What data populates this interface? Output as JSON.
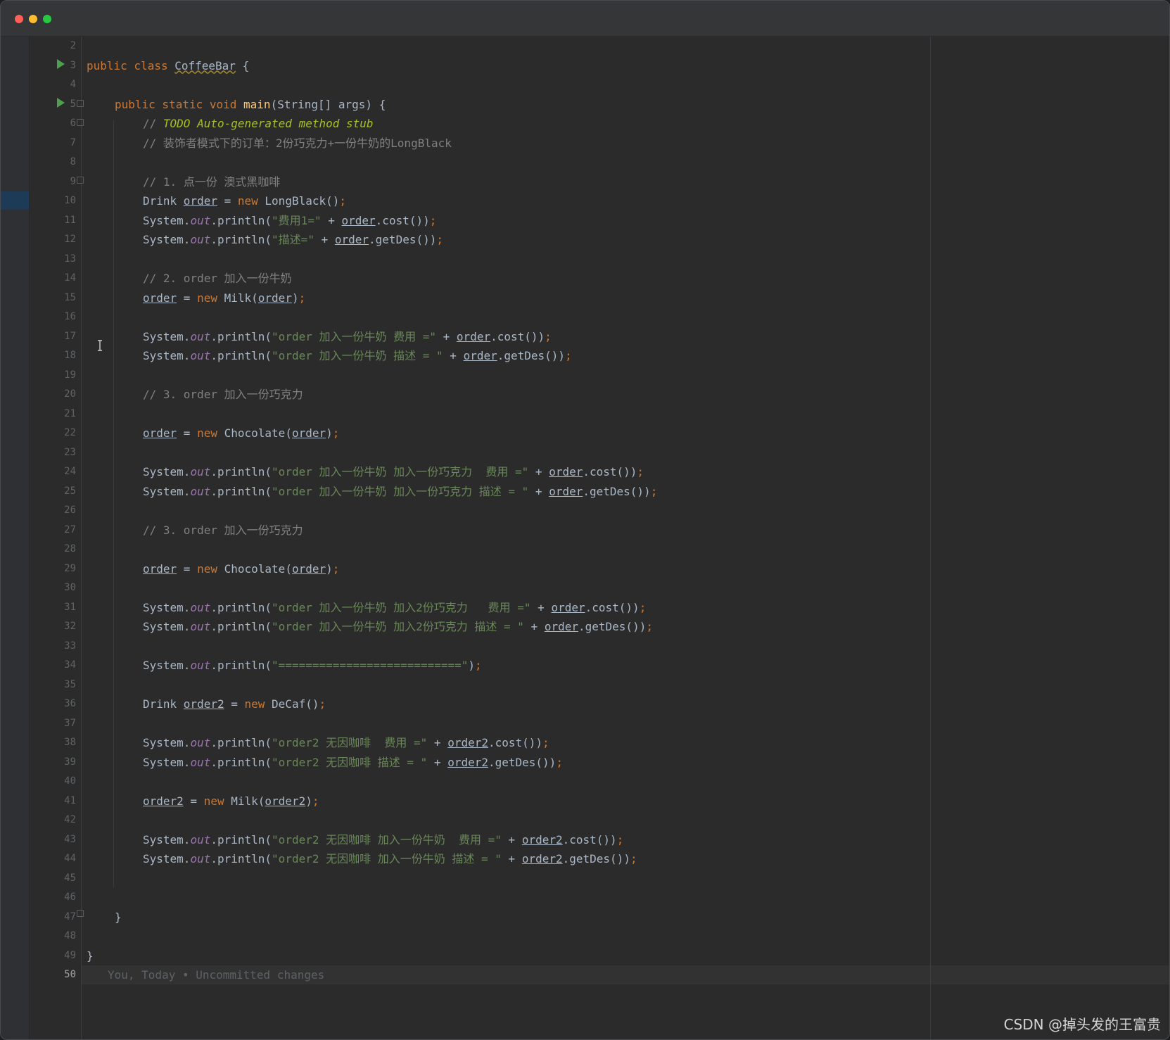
{
  "editor": {
    "current_line": "50",
    "blame_text": "You, Today • Uncommitted changes",
    "line_numbers": [
      "2",
      "3",
      "4",
      "5",
      "6",
      "7",
      "8",
      "9",
      "10",
      "11",
      "12",
      "13",
      "14",
      "15",
      "16",
      "17",
      "18",
      "19",
      "20",
      "21",
      "22",
      "23",
      "24",
      "25",
      "26",
      "27",
      "28",
      "29",
      "30",
      "31",
      "32",
      "33",
      "34",
      "35",
      "36",
      "37",
      "38",
      "39",
      "40",
      "41",
      "42",
      "43",
      "44",
      "45",
      "46",
      "47",
      "48",
      "49",
      "50"
    ]
  },
  "code": {
    "l3": {
      "kw": "public class ",
      "cls": "CoffeeBar",
      "rest": " {"
    },
    "l5": {
      "kw": "public static void ",
      "fn": "main",
      "rest": "(String[] args) {"
    },
    "l6": {
      "prefix": "// ",
      "todo": "TODO Auto-generated method stub"
    },
    "l7": {
      "text": "// 装饰者模式下的订单：2份巧克力+一份牛奶的LongBlack"
    },
    "l9": {
      "text": "// 1. 点一份 澳式黑咖啡"
    },
    "l10": {
      "t1": "Drink ",
      "v": "order",
      "t2": " = ",
      "kw": "new",
      "t3": " LongBlack()",
      "semi": ";"
    },
    "l11": {
      "sys": "System.",
      "out": "out",
      "pr": ".println(",
      "str": "\"费用1=\"",
      "plus": " + ",
      "v": "order",
      "end": ".cost())",
      "semi": ";"
    },
    "l12": {
      "sys": "System.",
      "out": "out",
      "pr": ".println(",
      "str": "\"描述=\"",
      "plus": " + ",
      "v": "order",
      "end": ".getDes())",
      "semi": ";"
    },
    "l14": {
      "text": "// 2. order 加入一份牛奶"
    },
    "l15": {
      "v": "order",
      "t2": " = ",
      "kw": "new",
      "t3": " Milk(",
      "v2": "order",
      "t4": ")",
      "semi": ";"
    },
    "l17": {
      "sys": "System.",
      "out": "out",
      "pr": ".println(",
      "str": "\"order 加入一份牛奶 费用 =\"",
      "plus": " + ",
      "v": "order",
      "end": ".cost())",
      "semi": ";"
    },
    "l18": {
      "sys": "System.",
      "out": "out",
      "pr": ".println(",
      "str": "\"order 加入一份牛奶 描述 = \"",
      "plus": " + ",
      "v": "order",
      "end": ".getDes())",
      "semi": ";"
    },
    "l20": {
      "text": "// 3. order 加入一份巧克力"
    },
    "l22": {
      "v": "order",
      "t2": " = ",
      "kw": "new",
      "t3": " Chocolate(",
      "v2": "order",
      "t4": ")",
      "semi": ";"
    },
    "l24": {
      "sys": "System.",
      "out": "out",
      "pr": ".println(",
      "str": "\"order 加入一份牛奶 加入一份巧克力  费用 =\"",
      "plus": " + ",
      "v": "order",
      "end": ".cost())",
      "semi": ";"
    },
    "l25": {
      "sys": "System.",
      "out": "out",
      "pr": ".println(",
      "str": "\"order 加入一份牛奶 加入一份巧克力 描述 = \"",
      "plus": " + ",
      "v": "order",
      "end": ".getDes())",
      "semi": ";"
    },
    "l27": {
      "text": "// 3. order 加入一份巧克力"
    },
    "l29": {
      "v": "order",
      "t2": " = ",
      "kw": "new",
      "t3": " Chocolate(",
      "v2": "order",
      "t4": ")",
      "semi": ";"
    },
    "l31": {
      "sys": "System.",
      "out": "out",
      "pr": ".println(",
      "str": "\"order 加入一份牛奶 加入2份巧克力   费用 =\"",
      "plus": " + ",
      "v": "order",
      "end": ".cost())",
      "semi": ";"
    },
    "l32": {
      "sys": "System.",
      "out": "out",
      "pr": ".println(",
      "str": "\"order 加入一份牛奶 加入2份巧克力 描述 = \"",
      "plus": " + ",
      "v": "order",
      "end": ".getDes())",
      "semi": ";"
    },
    "l34": {
      "sys": "System.",
      "out": "out",
      "pr": ".println(",
      "str": "\"===========================\"",
      "end": ")",
      "semi": ";"
    },
    "l36": {
      "t1": "Drink ",
      "v": "order2",
      "t2": " = ",
      "kw": "new",
      "t3": " DeCaf()",
      "semi": ";"
    },
    "l38": {
      "sys": "System.",
      "out": "out",
      "pr": ".println(",
      "str": "\"order2 无因咖啡  费用 =\"",
      "plus": " + ",
      "v": "order2",
      "end": ".cost())",
      "semi": ";"
    },
    "l39": {
      "sys": "System.",
      "out": "out",
      "pr": ".println(",
      "str": "\"order2 无因咖啡 描述 = \"",
      "plus": " + ",
      "v": "order2",
      "end": ".getDes())",
      "semi": ";"
    },
    "l41": {
      "v": "order2",
      "t2": " = ",
      "kw": "new",
      "t3": " Milk(",
      "v2": "order2",
      "t4": ")",
      "semi": ";"
    },
    "l43": {
      "sys": "System.",
      "out": "out",
      "pr": ".println(",
      "str": "\"order2 无因咖啡 加入一份牛奶  费用 =\"",
      "plus": " + ",
      "v": "order2",
      "end": ".cost())",
      "semi": ";"
    },
    "l44": {
      "sys": "System.",
      "out": "out",
      "pr": ".println(",
      "str": "\"order2 无因咖啡 加入一份牛奶 描述 = \"",
      "plus": " + ",
      "v": "order2",
      "end": ".getDes())",
      "semi": ";"
    },
    "l47": {
      "text": "}"
    },
    "l49": {
      "text": "}"
    }
  },
  "watermark": "CSDN @掉头发的王富贵"
}
